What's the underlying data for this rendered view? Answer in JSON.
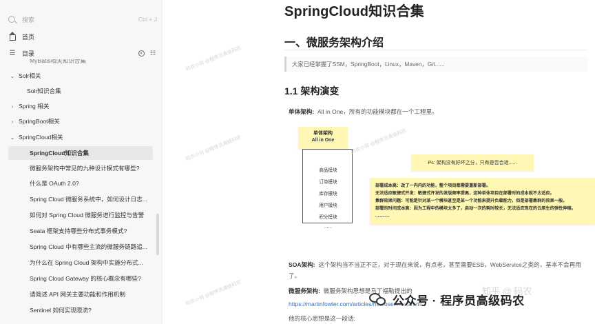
{
  "sidebar": {
    "search": {
      "placeholder": "搜索",
      "shortcut": "Ctrl + J"
    },
    "home_label": "首页",
    "toc_label": "目录",
    "tree": [
      {
        "label": "MyBatis相关知识合集",
        "chev": "",
        "type": "cut"
      },
      {
        "label": "Solr相关",
        "chev": "⌄",
        "type": "parent"
      },
      {
        "label": "Solr知识合集",
        "chev": "",
        "type": "child"
      },
      {
        "label": "Spring 相关",
        "chev": "›",
        "type": "parent"
      },
      {
        "label": "SpringBoot相关",
        "chev": "›",
        "type": "parent"
      },
      {
        "label": "SpringCloud相关",
        "chev": "⌄",
        "type": "parent"
      },
      {
        "label": "SpringCloud知识合集",
        "chev": "",
        "type": "active"
      },
      {
        "label": "微服务架构中常见的九种设计模式有哪些?",
        "chev": "",
        "type": "child"
      },
      {
        "label": "什么是 OAuth 2.0?",
        "chev": "",
        "type": "child"
      },
      {
        "label": "Spring Cloud 微服务系统中，如何设计日志...",
        "chev": "",
        "type": "child"
      },
      {
        "label": "如何对 Spring Cloud 微服务进行监控与告警",
        "chev": "",
        "type": "child"
      },
      {
        "label": "Seata 框架支持哪些分布式事务模式?",
        "chev": "",
        "type": "child"
      },
      {
        "label": "Spring Cloud 中有哪些主流的微服务链路追...",
        "chev": "",
        "type": "child"
      },
      {
        "label": "为什么在 Spring Cloud 架构中实施分布式...",
        "chev": "",
        "type": "child"
      },
      {
        "label": "Spring Cloud Gateway 的核心概念有哪些?",
        "chev": "",
        "type": "child"
      },
      {
        "label": "请简述 API 网关主要功能和作用机制",
        "chev": "",
        "type": "child"
      },
      {
        "label": "Sentinel 如何实现限流?",
        "chev": "",
        "type": "child"
      }
    ]
  },
  "doc": {
    "title": "SpringCloud知识合集",
    "h1": "一、微服务架构介绍",
    "quote": "大家已经掌握了SSM，SpringBoot，Linux，Maven，Git......",
    "h2": "1.1 架构演变",
    "p1_label": "单体架构:",
    "p1_text": "All in One，所有的功能模块都在一个工程里。",
    "diagram": {
      "sticky_title": "单体架构\nAll in One",
      "modules": [
        "商品模块",
        "订单模块",
        "库存模块",
        "用户模块",
        "积分模块",
        "......"
      ],
      "ps_note": "Ps: 架构没有好坏之分，只有是否合适......",
      "notes": [
        "部署成本高：改了一内内的功能，整个项目都需要重新部署。",
        "无法适应敏捷式开发：敏捷式开发的发版频率提高，这种单体项目在部署时的成本就不太适应。",
        "集群效果问题：可能是针对某一个模块甚至是某一个功能来提升负载能力，但是部署集群的效果一般。",
        "部署的时间成本高：因为工程中的模块太多了，启动一次的耗时较长，无法适应现在的云原生的弹性伸缩。",
        "............"
      ]
    },
    "p2_label": "SOA架构:",
    "p2_text": "这个架构当不当正不正，对于现在来说，有点老，甚至需要ESB，WebService之类的，基本不会再用了。",
    "p3_label": "微服务架构:",
    "p3_text": "微服务架构思想是马丁福勒提出的",
    "link": "https://martinfowler.com/articles/microservices.html",
    "p4_text": "他的核心思想是这一段话:"
  },
  "overlay": {
    "text": "公众号 · 程序员高级码农",
    "faint": "知乎 @ 码农"
  },
  "watermark": "码农小何 @程序员高级码农"
}
